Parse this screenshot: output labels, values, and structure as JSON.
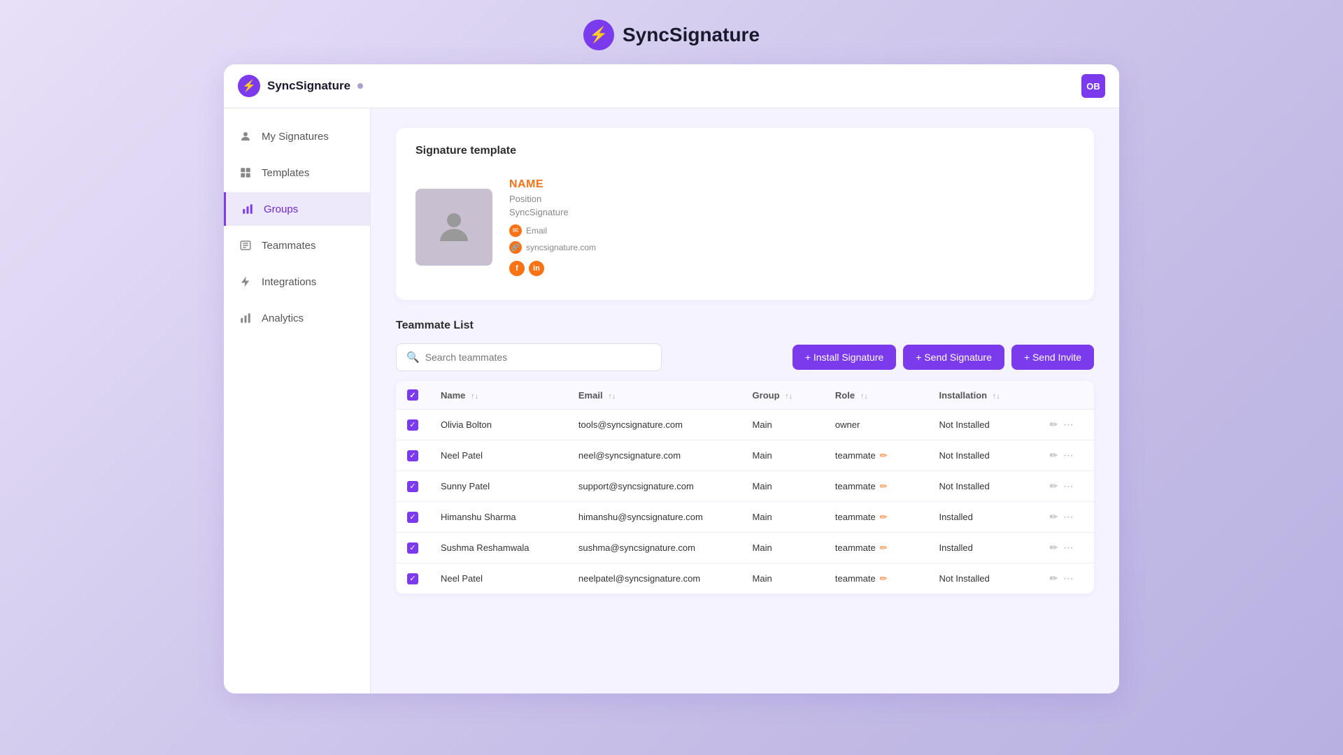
{
  "app": {
    "name": "SyncSignature",
    "brand_initials": "OB",
    "status_dot": "online"
  },
  "top_header": {
    "logo_text": "SyncSignature",
    "logo_symbol": "⚡"
  },
  "sidebar": {
    "items": [
      {
        "id": "my-signatures",
        "label": "My Signatures",
        "icon": "person",
        "active": false
      },
      {
        "id": "templates",
        "label": "Templates",
        "icon": "grid",
        "active": false
      },
      {
        "id": "groups",
        "label": "Groups",
        "icon": "bar-chart",
        "active": true
      },
      {
        "id": "teammates",
        "label": "Teammates",
        "icon": "list",
        "active": false
      },
      {
        "id": "integrations",
        "label": "Integrations",
        "icon": "lightning",
        "active": false
      },
      {
        "id": "analytics",
        "label": "Analytics",
        "icon": "bar-chart2",
        "active": false
      }
    ]
  },
  "signature_template": {
    "section_title": "Signature template",
    "name": "NAME",
    "position": "Position",
    "company": "SyncSignature",
    "email_label": "Email",
    "website": "syncsignature.com"
  },
  "teammate_list": {
    "section_title": "Teammate List",
    "search_placeholder": "Search teammates",
    "buttons": [
      {
        "id": "install-signature",
        "label": "+ Install Signature"
      },
      {
        "id": "send-signature",
        "label": "+ Send Signature"
      },
      {
        "id": "send-invite",
        "label": "+ Send Invite"
      }
    ],
    "columns": [
      {
        "id": "name",
        "label": "Name"
      },
      {
        "id": "email",
        "label": "Email"
      },
      {
        "id": "group",
        "label": "Group"
      },
      {
        "id": "role",
        "label": "Role"
      },
      {
        "id": "installation",
        "label": "Installation"
      }
    ],
    "rows": [
      {
        "id": 1,
        "checked": true,
        "name": "Olivia Bolton",
        "email": "tools@syncsignature.com",
        "group": "Main",
        "role": "owner",
        "role_editable": false,
        "installation": "Not Installed"
      },
      {
        "id": 2,
        "checked": true,
        "name": "Neel Patel",
        "email": "neel@syncsignature.com",
        "group": "Main",
        "role": "teammate",
        "role_editable": true,
        "installation": "Not Installed"
      },
      {
        "id": 3,
        "checked": true,
        "name": "Sunny Patel",
        "email": "support@syncsignature.com",
        "group": "Main",
        "role": "teammate",
        "role_editable": true,
        "installation": "Not Installed"
      },
      {
        "id": 4,
        "checked": true,
        "name": "Himanshu Sharma",
        "email": "himanshu@syncsignature.com",
        "group": "Main",
        "role": "teammate",
        "role_editable": true,
        "installation": "Installed"
      },
      {
        "id": 5,
        "checked": true,
        "name": "Sushma Reshamwala",
        "email": "sushma@syncsignature.com",
        "group": "Main",
        "role": "teammate",
        "role_editable": true,
        "installation": "Installed"
      },
      {
        "id": 6,
        "checked": true,
        "name": "Neel Patel",
        "email": "neelpatel@syncsignature.com",
        "group": "Main",
        "role": "teammate",
        "role_editable": true,
        "installation": "Not Installed"
      }
    ]
  }
}
